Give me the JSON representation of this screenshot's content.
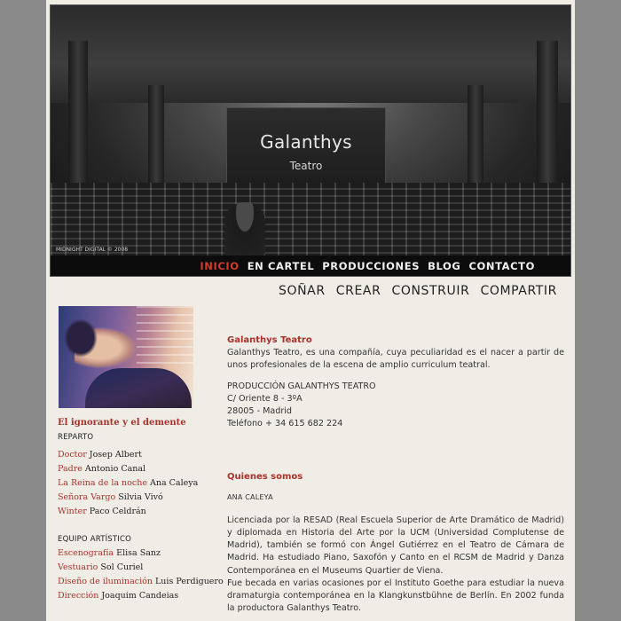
{
  "banner": {
    "title": "Galanthys",
    "subtitle": "Teatro",
    "credit": "MIDNIGHT DIGITAL © 2008"
  },
  "nav": {
    "items": [
      {
        "label": "INICIO",
        "active": true
      },
      {
        "label": "EN CARTEL",
        "active": false
      },
      {
        "label": "PRODUCCIONES",
        "active": false
      },
      {
        "label": "BLOG",
        "active": false
      },
      {
        "label": "CONTACTO",
        "active": false
      }
    ]
  },
  "tagline": [
    "SOÑAR",
    "CREAR",
    "CONSTRUIR",
    "COMPARTIR"
  ],
  "show": {
    "title": "El ignorante y el demente",
    "cast_heading": "REPARTO",
    "cast": [
      {
        "role": "Doctor",
        "name": "Josep Albert"
      },
      {
        "role": "Padre",
        "name": "Antonio Canal"
      },
      {
        "role": "La Reina de la noche",
        "name": "Ana Caleya"
      },
      {
        "role": "Señora Vargo",
        "name": "Silvia Vivó"
      },
      {
        "role": "Winter",
        "name": "Paco Celdrán"
      }
    ],
    "team_heading": "EQUIPO ARTÍSTICO",
    "team": [
      {
        "role": "Escenografía",
        "name": "Elisa Sanz"
      },
      {
        "role": "Vestuario",
        "name": "Sol Curiel"
      },
      {
        "role": "Diseño de iluminación",
        "name": "Luis Perdiguero"
      },
      {
        "role": "Dirección",
        "name": "Joaquim Candeias"
      }
    ]
  },
  "intro": {
    "heading": "Galanthys Teatro",
    "text": "Galanthys Teatro, es una compañía, cuya peculiaridad es el nacer a partir de unos profesionales de la escena de amplio curriculum teatral.",
    "contact": [
      "PRODUCCIÓN GALANTHYS TEATRO",
      "C/ Oriente 8 - 3ºA",
      "28005 - Madrid",
      "Teléfono + 34 615 682 224"
    ]
  },
  "about": {
    "heading": "Quienes somos",
    "name": "ANA CALEYA",
    "paragraph1": "Licenciada por la RESAD (Real Escuela Superior de Arte Dramático de Madrid) y diplomada en Historia del Arte por la UCM (Universidad Complutense de Madrid), también se formó con Ángel Gutiérrez en el Teatro de Cámara de Madrid. Ha estudiado Piano, Saxofón y Canto en el RCSM de Madrid y Danza Contemporánea en el Museums Quartier de Viena.",
    "paragraph2": "Fue becada en varias ocasiones por el Instituto Goethe para estudiar la nueva dramaturgia contemporánea en la Klangkunstbühne de Berlín. En 2002 funda la productora Galanthys Teatro."
  }
}
